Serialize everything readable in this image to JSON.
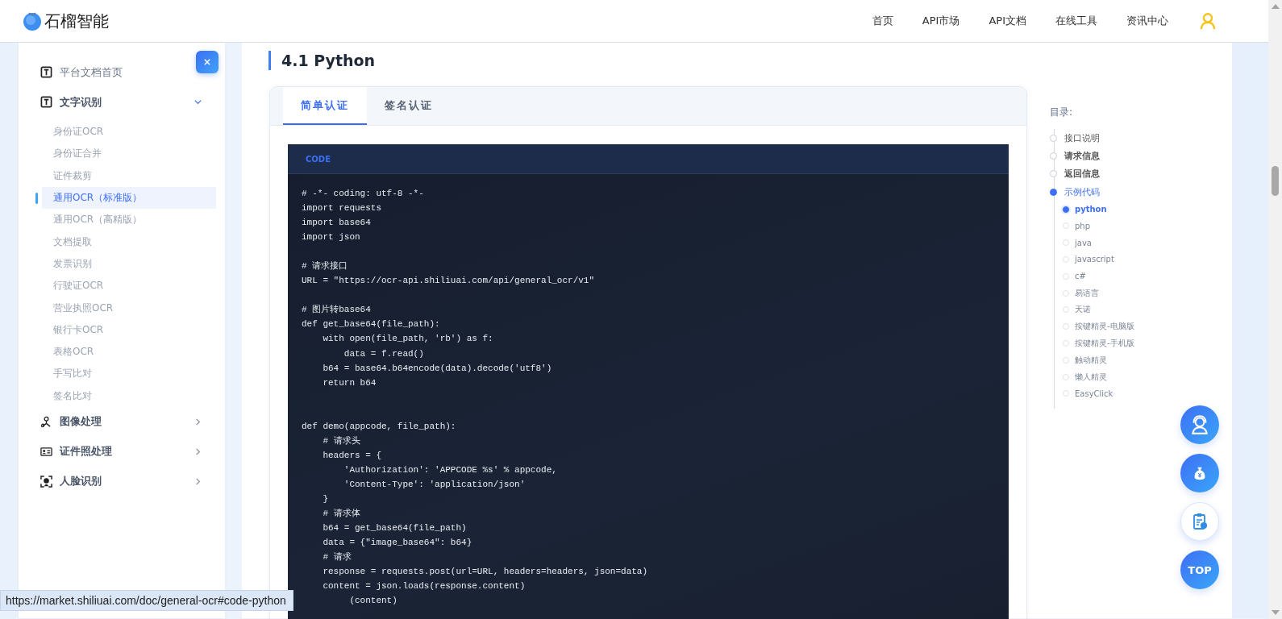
{
  "header": {
    "logo_text": "石榴智能",
    "nav": [
      {
        "label": "首页"
      },
      {
        "label": "API市场"
      },
      {
        "label": "API文档"
      },
      {
        "label": "在线工具"
      },
      {
        "label": "资讯中心"
      }
    ]
  },
  "sidebar": {
    "items": [
      {
        "label": "平台文档首页",
        "kind": "page"
      },
      {
        "label": "文字识别",
        "kind": "group",
        "expanded": true,
        "children": [
          {
            "label": "身份证OCR",
            "selected": false
          },
          {
            "label": "身份证合并",
            "selected": false
          },
          {
            "label": "证件裁剪",
            "selected": false
          },
          {
            "label": "通用OCR（标准版）",
            "selected": true
          },
          {
            "label": "通用OCR（高精版）",
            "selected": false
          },
          {
            "label": "文档提取",
            "selected": false
          },
          {
            "label": "发票识别",
            "selected": false
          },
          {
            "label": "行驶证OCR",
            "selected": false
          },
          {
            "label": "营业执照OCR",
            "selected": false
          },
          {
            "label": "银行卡OCR",
            "selected": false
          },
          {
            "label": "表格OCR",
            "selected": false
          },
          {
            "label": "手写比对",
            "selected": false
          },
          {
            "label": "签名比对",
            "selected": false
          }
        ]
      },
      {
        "label": "图像处理",
        "kind": "group",
        "expanded": false
      },
      {
        "label": "证件照处理",
        "kind": "group",
        "expanded": false
      },
      {
        "label": "人脸识别",
        "kind": "group",
        "expanded": false
      }
    ]
  },
  "content": {
    "title": "4.1 Python",
    "tabs": [
      {
        "label": "简单认证",
        "selected": true
      },
      {
        "label": "签名认证",
        "selected": false
      }
    ],
    "code_block": {
      "header": "CODE",
      "code": "# -*- coding: utf-8 -*-\nimport requests\nimport base64\nimport json\n\n# 请求接口\nURL = \"https://ocr-api.shiliuai.com/api/general_ocr/v1\"\n\n# 图片转base64\ndef get_base64(file_path):\n    with open(file_path, 'rb') as f:\n        data = f.read()\n    b64 = base64.b64encode(data).decode('utf8')\n    return b64\n\n\ndef demo(appcode, file_path):\n    # 请求头\n    headers = {\n        'Authorization': 'APPCODE %s' % appcode,\n        'Content-Type': 'application/json'\n    }\n    # 请求体\n    b64 = get_base64(file_path)\n    data = {\"image_base64\": b64}\n    # 请求\n    response = requests.post(url=URL, headers=headers, json=data)\n    content = json.loads(response.content)\n         (content)"
    }
  },
  "toc": {
    "title": "目录:",
    "items": [
      {
        "label": "接口说明",
        "selected": false,
        "emphasized": false
      },
      {
        "label": "请求信息",
        "selected": false,
        "emphasized": true
      },
      {
        "label": "返回信息",
        "selected": false,
        "emphasized": true
      },
      {
        "label": "示例代码",
        "selected": true,
        "emphasized": false,
        "children": [
          {
            "label": "python",
            "selected": true
          },
          {
            "label": "php",
            "selected": false
          },
          {
            "label": "java",
            "selected": false
          },
          {
            "label": "javascript",
            "selected": false
          },
          {
            "label": "c#",
            "selected": false
          },
          {
            "label": "易语言",
            "selected": false
          },
          {
            "label": "天诺",
            "selected": false
          },
          {
            "label": "按键精灵-电脑版",
            "selected": false
          },
          {
            "label": "按键精灵-手机版",
            "selected": false
          },
          {
            "label": "触动精灵",
            "selected": false
          },
          {
            "label": "懒人精灵",
            "selected": false
          },
          {
            "label": "EasyClick",
            "selected": false
          }
        ]
      }
    ]
  },
  "float_buttons": {
    "top_label": "TOP"
  },
  "status_url": "https://market.shiliuai.com/doc/general-ocr#code-python"
}
